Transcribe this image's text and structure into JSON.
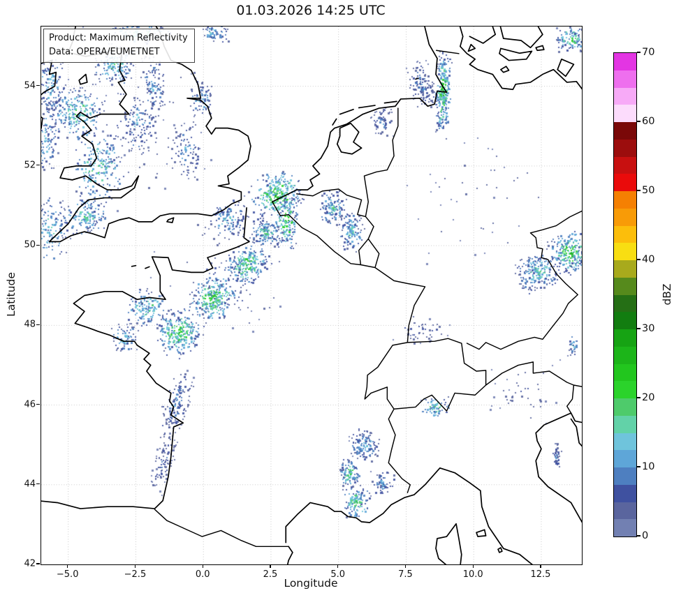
{
  "title": "01.03.2026 14:25 UTC",
  "info_box": {
    "line1": "Product: Maximum Reflectivity",
    "line2": "Data: OPERA/EUMETNET"
  },
  "axes": {
    "xlabel": "Longitude",
    "ylabel": "Latitude",
    "lon_range": [
      -6,
      14
    ],
    "lat_range": [
      42,
      55.5
    ],
    "x_ticks": [
      {
        "value": -5,
        "label": "−5.0"
      },
      {
        "value": -2.5,
        "label": "−2.5"
      },
      {
        "value": 0,
        "label": "0.0"
      },
      {
        "value": 2.5,
        "label": "2.5"
      },
      {
        "value": 5,
        "label": "5.0"
      },
      {
        "value": 7.5,
        "label": "7.5"
      },
      {
        "value": 10,
        "label": "10.0"
      },
      {
        "value": 12.5,
        "label": "12.5"
      }
    ],
    "y_ticks": [
      {
        "value": 42,
        "label": "42"
      },
      {
        "value": 44,
        "label": "44"
      },
      {
        "value": 46,
        "label": "46"
      },
      {
        "value": 48,
        "label": "48"
      },
      {
        "value": 50,
        "label": "50"
      },
      {
        "value": 52,
        "label": "52"
      },
      {
        "value": 54,
        "label": "54"
      }
    ],
    "grid_lon": [
      -5,
      -2.5,
      0,
      2.5,
      5,
      7.5,
      10,
      12.5
    ],
    "grid_lat": [
      44,
      46,
      48,
      50,
      52,
      54
    ],
    "grid_color": "#c6c6c6"
  },
  "colorbar": {
    "label": "dBZ",
    "min": 0,
    "max": 70,
    "step": 2.5,
    "ticks": [
      0,
      10,
      20,
      30,
      40,
      50,
      60,
      70
    ],
    "colors_bottom_to_top": [
      "#7280b2",
      "#5a659e",
      "#3f51a0",
      "#4e7fc0",
      "#5ea6d8",
      "#6fc4dc",
      "#62d2a8",
      "#4ecb6b",
      "#2bd32b",
      "#22c61e",
      "#1cb519",
      "#16a313",
      "#127d10",
      "#256f15",
      "#568a1c",
      "#a8aa1c",
      "#f8de12",
      "#fcbe0b",
      "#f89b07",
      "#f58002",
      "#ea0b0b",
      "#c81010",
      "#9c0d0d",
      "#7a0808",
      "#fcdcfc",
      "#f7aaf7",
      "#ee6fee",
      "#e335e3"
    ]
  },
  "chart_data": {
    "type": "heatmap",
    "title": "01.03.2026 14:25 UTC",
    "product": "Maximum Reflectivity",
    "data_source": "OPERA/EUMETNET",
    "units": "dBZ",
    "value_range": [
      0,
      70
    ],
    "extent_lon": [
      -6,
      14
    ],
    "extent_lat": [
      42,
      55.5
    ],
    "cluster_format": [
      "lon_center",
      "lat_center",
      "radius_lon_deg",
      "radius_lat_deg",
      "rotation_deg",
      "speck_count",
      "max_dbz"
    ],
    "echo_clusters": [
      [
        -4.7,
        53.35,
        1.05,
        0.75,
        0,
        240,
        24
      ],
      [
        -3.3,
        54.55,
        0.85,
        0.55,
        0,
        160,
        22
      ],
      [
        -5.7,
        54.05,
        0.55,
        0.8,
        0,
        120,
        18
      ],
      [
        -5.85,
        52.7,
        0.5,
        0.95,
        0,
        110,
        18
      ],
      [
        -5.8,
        50.4,
        0.8,
        0.9,
        0,
        150,
        20
      ],
      [
        -3.9,
        52.0,
        0.95,
        0.95,
        0,
        200,
        24
      ],
      [
        -4.4,
        50.75,
        0.95,
        0.5,
        -20,
        150,
        22
      ],
      [
        -2.5,
        53.1,
        0.8,
        0.9,
        0,
        110,
        15
      ],
      [
        -1.9,
        54.0,
        0.55,
        0.9,
        0,
        100,
        15
      ],
      [
        -0.7,
        52.4,
        0.7,
        0.8,
        0,
        90,
        14
      ],
      [
        0.9,
        50.7,
        0.8,
        0.55,
        0,
        120,
        18
      ],
      [
        -2.4,
        55.35,
        1.3,
        0.3,
        0,
        110,
        22
      ],
      [
        0.4,
        55.35,
        0.6,
        0.25,
        0,
        60,
        20
      ],
      [
        -0.1,
        53.7,
        0.5,
        0.5,
        0,
        70,
        16
      ],
      [
        2.7,
        51.3,
        1.05,
        0.6,
        -15,
        300,
        30
      ],
      [
        3.05,
        50.6,
        0.45,
        0.7,
        0,
        150,
        30
      ],
      [
        4.75,
        50.95,
        0.55,
        0.5,
        0,
        120,
        20
      ],
      [
        5.45,
        50.35,
        0.5,
        0.55,
        0,
        120,
        20
      ],
      [
        2.3,
        50.35,
        0.55,
        0.45,
        -40,
        130,
        22
      ],
      [
        -0.95,
        47.85,
        0.95,
        0.6,
        -40,
        280,
        28
      ],
      [
        0.35,
        48.7,
        0.95,
        0.55,
        -40,
        280,
        30
      ],
      [
        1.6,
        49.55,
        0.85,
        0.5,
        -40,
        240,
        28
      ],
      [
        -2.1,
        48.45,
        0.85,
        0.5,
        0,
        140,
        22
      ],
      [
        -2.95,
        47.7,
        0.55,
        0.4,
        0,
        80,
        18
      ],
      [
        -1.05,
        46.05,
        0.5,
        0.95,
        18,
        150,
        13
      ],
      [
        -1.5,
        44.55,
        0.4,
        0.85,
        15,
        90,
        10
      ],
      [
        8.85,
        53.85,
        0.3,
        1.05,
        2,
        280,
        30
      ],
      [
        8.05,
        54.05,
        0.55,
        0.65,
        -18,
        130,
        13
      ],
      [
        13.6,
        55.2,
        0.65,
        0.35,
        0,
        120,
        26
      ],
      [
        6.6,
        53.1,
        0.5,
        0.4,
        0,
        60,
        12
      ],
      [
        12.35,
        49.35,
        0.85,
        0.5,
        -25,
        220,
        22
      ],
      [
        13.55,
        49.85,
        0.75,
        0.55,
        -25,
        240,
        30
      ],
      [
        5.9,
        45.0,
        0.6,
        0.45,
        0,
        130,
        17
      ],
      [
        5.4,
        44.3,
        0.4,
        0.4,
        0,
        100,
        26
      ],
      [
        5.65,
        43.6,
        0.55,
        0.45,
        0,
        120,
        26
      ],
      [
        6.6,
        44.05,
        0.5,
        0.35,
        0,
        60,
        15
      ],
      [
        8.55,
        45.95,
        0.6,
        0.3,
        0,
        70,
        24
      ],
      [
        13.05,
        44.75,
        0.18,
        0.35,
        0,
        40,
        14
      ],
      [
        13.65,
        47.5,
        0.2,
        0.3,
        0,
        25,
        18
      ],
      [
        -2.5,
        53.2,
        3.2,
        2.6,
        0,
        90,
        8
      ],
      [
        0.8,
        49.3,
        2.6,
        2.0,
        -30,
        70,
        8
      ],
      [
        10.0,
        51.3,
        3.0,
        2.2,
        0,
        45,
        6
      ],
      [
        8.0,
        47.9,
        1.2,
        0.4,
        0,
        45,
        9
      ],
      [
        11.8,
        46.4,
        1.5,
        0.9,
        0,
        40,
        8
      ]
    ]
  }
}
